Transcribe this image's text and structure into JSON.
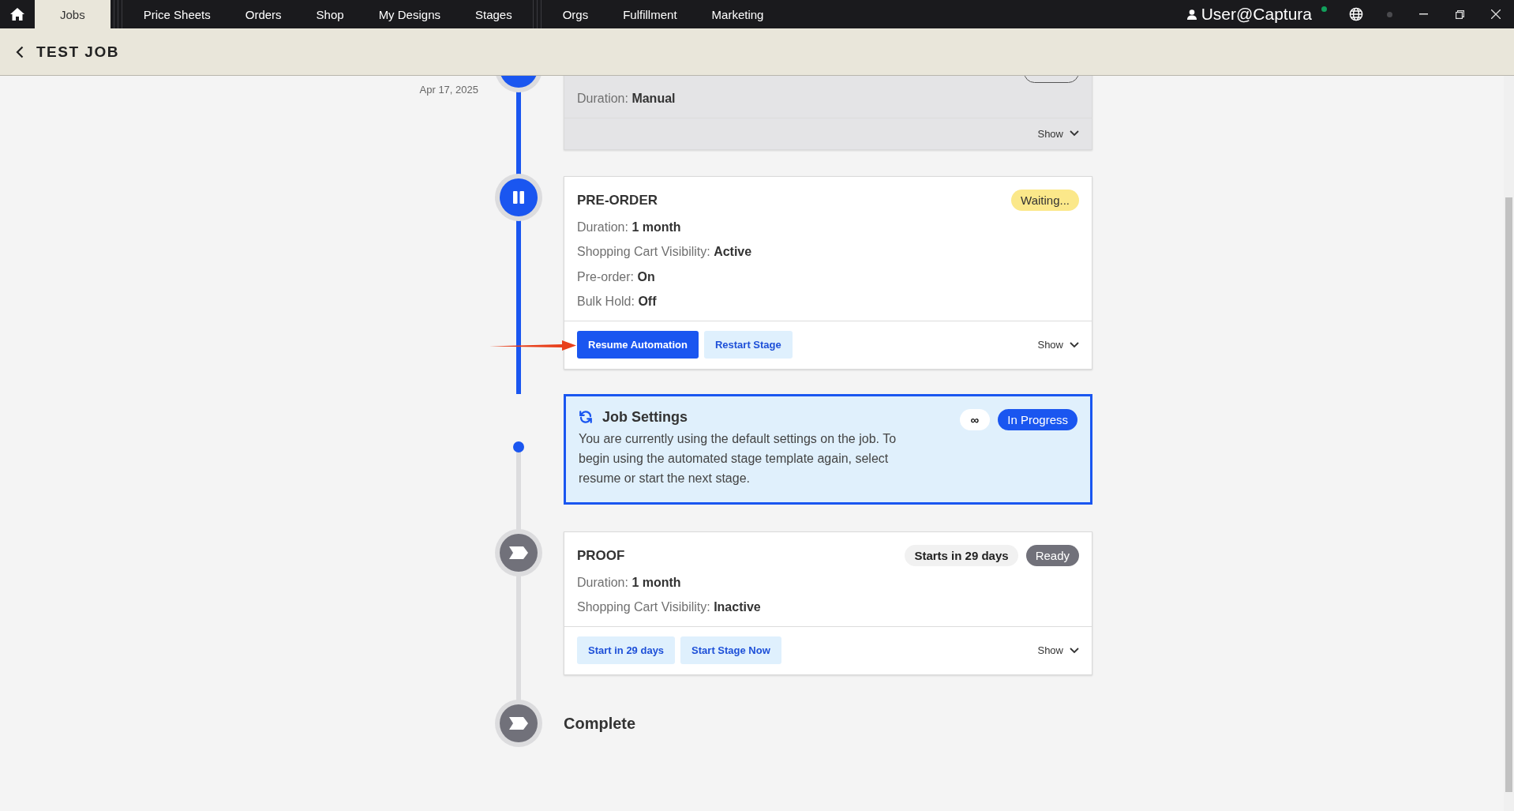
{
  "nav": {
    "groups": [
      [
        {
          "label": "Jobs",
          "selected": true
        }
      ],
      [
        {
          "label": "Price Sheets",
          "selected": false
        },
        {
          "label": "Orders",
          "selected": false
        },
        {
          "label": "Shop",
          "selected": false
        },
        {
          "label": "My Designs",
          "selected": false
        },
        {
          "label": "Stages",
          "selected": false
        }
      ],
      [
        {
          "label": "Orgs",
          "selected": false
        },
        {
          "label": "Fulfillment",
          "selected": false
        },
        {
          "label": "Marketing",
          "selected": false
        }
      ]
    ],
    "user": "User@Captura",
    "online": true
  },
  "header": {
    "title": "TEST JOB"
  },
  "stages": [
    {
      "kind": "card",
      "date": "Apr 17, 2025",
      "muted": true,
      "reached": true,
      "paused": false,
      "passed": true,
      "badges": [
        {
          "kind": "outline"
        }
      ],
      "details": [
        {
          "label": "Duration:",
          "value": "Manual"
        }
      ],
      "toggle": "Show"
    },
    {
      "kind": "card",
      "muted": false,
      "reached": true,
      "paused": true,
      "passed": true,
      "title": "PRE-ORDER",
      "badges": [
        {
          "text": "Waiting...",
          "kind": "warning"
        }
      ],
      "details": [
        {
          "label": "Duration:",
          "value": "1 month"
        },
        {
          "label": "Shopping Cart Visibility:",
          "value": "Active"
        },
        {
          "label": "Pre-order:",
          "value": "On"
        },
        {
          "label": "Bulk Hold:",
          "value": "Off"
        }
      ],
      "actions": [
        {
          "label": "Resume Automation",
          "kind": "primary",
          "pointed": true
        },
        {
          "label": "Restart Stage",
          "kind": "secondary",
          "pointed": false
        }
      ],
      "toggle": "Show"
    },
    {
      "kind": "notice",
      "reached": true,
      "passed": false,
      "title": "Job Settings",
      "text": "You are currently using the default settings on the job. To begin using the automated stage template again, select resume or start the next stage.",
      "badges": [
        {
          "text": "∞",
          "kind": "plain"
        },
        {
          "text": "In Progress",
          "kind": "primary"
        }
      ]
    },
    {
      "kind": "card",
      "muted": false,
      "reached": false,
      "paused": false,
      "passed": false,
      "title": "PROOF",
      "badges": [
        {
          "text": "Starts in 29 days",
          "kind": "light"
        },
        {
          "text": "Ready",
          "kind": "dark"
        }
      ],
      "details": [
        {
          "label": "Duration:",
          "value": "1 month"
        },
        {
          "label": "Shopping Cart Visibility:",
          "value": "Inactive"
        }
      ],
      "actions": [
        {
          "label": "Start in 29 days",
          "kind": "secondary",
          "pointed": false
        },
        {
          "label": "Start Stage Now",
          "kind": "secondary",
          "pointed": false
        }
      ],
      "toggle": "Show"
    },
    {
      "kind": "end",
      "reached": false,
      "paused": false,
      "title": "Complete"
    }
  ]
}
